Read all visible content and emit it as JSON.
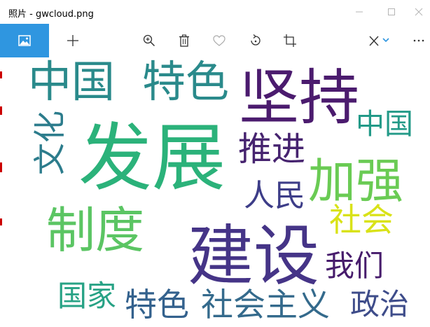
{
  "window": {
    "title": "照片 - gwcloud.png"
  },
  "toolbar": {
    "items": [
      {
        "name": "image-icon",
        "active": true
      },
      {
        "name": "plus-icon"
      },
      {
        "name": "zoom-in-icon"
      },
      {
        "name": "trash-icon"
      },
      {
        "name": "heart-icon"
      },
      {
        "name": "rotate-icon"
      },
      {
        "name": "crop-icon"
      },
      {
        "name": "edit-draw-icon"
      },
      {
        "name": "more-icon"
      }
    ],
    "accent_color": "#2f96e0"
  },
  "wordcloud": {
    "words": [
      {
        "text": "中国",
        "color": "#2a8a8b"
      },
      {
        "text": "特色",
        "color": "#2a8a8b"
      },
      {
        "text": "坚持",
        "color": "#4b1b6e"
      },
      {
        "text": "中国",
        "color": "#239a88"
      },
      {
        "text": "文化",
        "color": "#2c7c8c"
      },
      {
        "text": "发展",
        "color": "#2bb27a"
      },
      {
        "text": "推进",
        "color": "#46236f"
      },
      {
        "text": "加强",
        "color": "#6acb54"
      },
      {
        "text": "人民",
        "color": "#3d3d88"
      },
      {
        "text": "制度",
        "color": "#5bc563"
      },
      {
        "text": "社会",
        "color": "#d9e218"
      },
      {
        "text": "建设",
        "color": "#453487"
      },
      {
        "text": "我们",
        "color": "#471c6c"
      },
      {
        "text": "国家",
        "color": "#27a285"
      },
      {
        "text": "特色",
        "color": "#33618d"
      },
      {
        "text": "社会主义",
        "color": "#346a8c"
      },
      {
        "text": "政治",
        "color": "#3e4c8a"
      }
    ]
  }
}
